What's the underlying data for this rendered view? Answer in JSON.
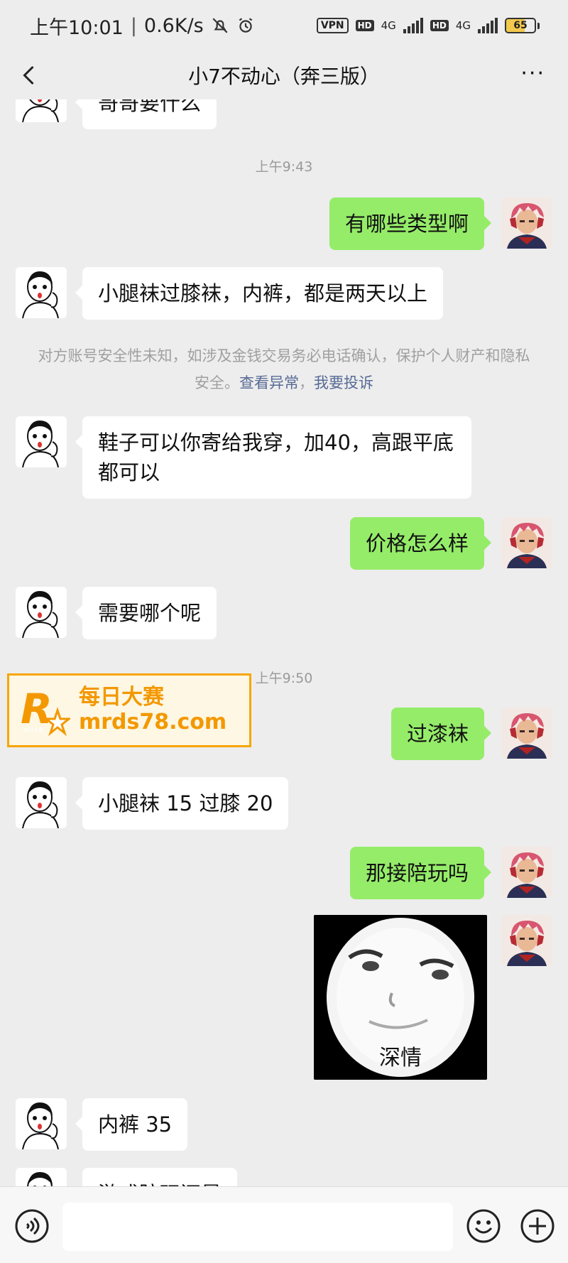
{
  "status_bar": {
    "time": "上午10:01",
    "network_speed": "0.6K/s",
    "vpn_label": "VPN",
    "hd_label": "HD",
    "net_type_1": "4G",
    "net_type_2": "4G",
    "battery": "65",
    "battery_level": 0.65,
    "battery_color": "#f2c94c"
  },
  "header": {
    "title": "小7不动心（奔三版）",
    "back_icon": "chevron-left-icon",
    "more_label": "···"
  },
  "colors": {
    "sent_bubble": "#95ec69",
    "received_bubble": "#ffffff",
    "background": "#ededed",
    "link": "#576b95",
    "watermark": "#f39800"
  },
  "chat": {
    "partial_top_text": "哥哥要什么",
    "timestamps": [
      "上午9:43",
      "上午9:50"
    ],
    "messages": [
      {
        "from": "me",
        "text": "有哪些类型啊"
      },
      {
        "from": "them",
        "text": "小腿袜过膝袜，内裤，都是两天以上"
      },
      {
        "from": "them",
        "text": "鞋子可以你寄给我穿，加40，高跟平底都可以"
      },
      {
        "from": "me",
        "text": "价格怎么样"
      },
      {
        "from": "them",
        "text": "需要哪个呢"
      },
      {
        "from": "me",
        "text": "过漆袜"
      },
      {
        "from": "them",
        "text": "小腿袜 15 过膝 20"
      },
      {
        "from": "me",
        "text": "那接陪玩吗"
      },
      {
        "from": "them",
        "text": "内裤 35"
      }
    ],
    "sticker_caption": "深情",
    "partial_bottom_text": "游戏陪玩还是",
    "notice": {
      "text": "对方账号安全性未知，如涉及金钱交易务必电话确认，保护个人财产和隐私安全。",
      "link_1": "查看异常",
      "separator": "，",
      "link_2": "我要投诉"
    }
  },
  "watermark": {
    "cn_text": "每日大赛",
    "url": "mrds78.com",
    "logo_letter": "R",
    "logo_small": "每日大赛"
  },
  "input_bar": {
    "placeholder": ""
  }
}
